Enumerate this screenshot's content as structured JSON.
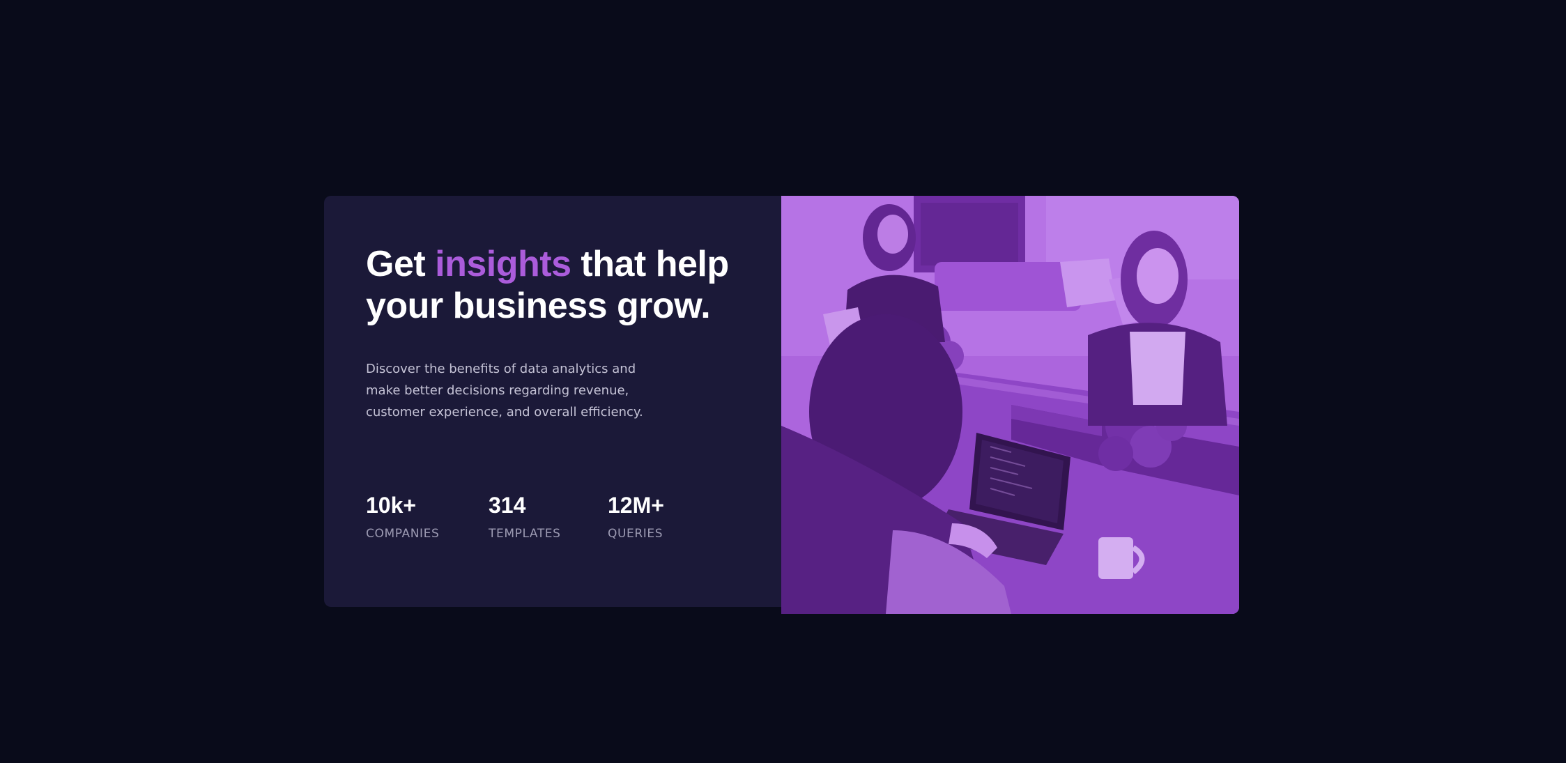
{
  "hero": {
    "headline_before": "Get ",
    "headline_accent": "insights",
    "headline_after": " that help your business grow.",
    "description": "Discover the benefits of data analytics and make better decisions regarding revenue, customer experience, and overall efficiency."
  },
  "stats": [
    {
      "value": "10k+",
      "label": "COMPANIES"
    },
    {
      "value": "314",
      "label": "TEMPLATES"
    },
    {
      "value": "12M+",
      "label": "QUERIES"
    }
  ],
  "colors": {
    "page_background": "#090b1a",
    "card_background": "#1b1938",
    "accent": "#ab5cdb",
    "heading": "#ffffff",
    "body_text": "#c5c3d6",
    "stat_label": "#9d9bb3"
  }
}
